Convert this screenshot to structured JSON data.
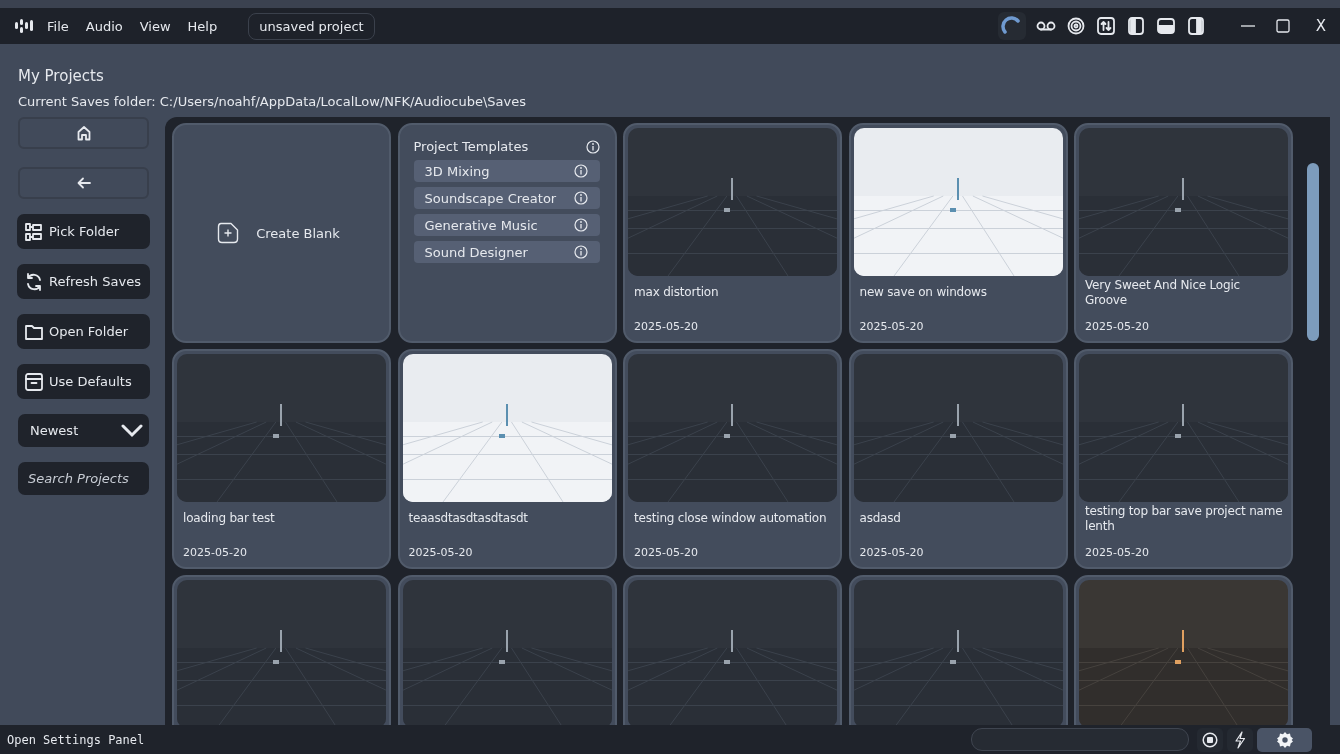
{
  "menu_bar": {
    "menus": [
      "File",
      "Audio",
      "View",
      "Help"
    ],
    "project_name": "unsaved project",
    "close_label": "X"
  },
  "header": {
    "title": "My Projects",
    "saves_folder": "Current Saves folder: C:/Users/noahf/AppData/LocalLow/NFK/Audiocube\\Saves"
  },
  "sidebar": {
    "actions": [
      {
        "kind": "pick",
        "label": "Pick Folder"
      },
      {
        "kind": "refresh",
        "label": "Refresh Saves"
      },
      {
        "kind": "open",
        "label": "Open Folder"
      },
      {
        "kind": "defaults",
        "label": "Use Defaults"
      }
    ],
    "sort": "Newest",
    "search": {
      "placeholder": "Search Projects"
    }
  },
  "create_blank": {
    "label": "Create Blank"
  },
  "templates": {
    "title": "Project Templates",
    "items": [
      "3D Mixing",
      "Soundscape Creator",
      "Generative Music",
      "Sound Designer"
    ]
  },
  "projects": [
    {
      "kind": "dark",
      "name": "max distortion",
      "date": "2025-05-20"
    },
    {
      "kind": "light",
      "name": "new save on windows",
      "date": "2025-05-20"
    },
    {
      "kind": "dark",
      "name": "Very Sweet And Nice Logic Groove",
      "date": "2025-05-20"
    },
    {
      "kind": "dark",
      "name": "loading bar test",
      "date": "2025-05-20"
    },
    {
      "kind": "light",
      "name": "teaasdtasdtasdtasdt",
      "date": "2025-05-20"
    },
    {
      "kind": "dark",
      "name": "testing close window automation",
      "date": "2025-05-20"
    },
    {
      "kind": "dark",
      "name": "asdasd",
      "date": "2025-05-20"
    },
    {
      "kind": "dark",
      "name": "testing top bar save project name lenth",
      "date": "2025-05-20"
    },
    {
      "kind": "dark"
    },
    {
      "kind": "dark"
    },
    {
      "kind": "dark"
    },
    {
      "kind": "dark"
    },
    {
      "kind": "warm"
    }
  ],
  "status_bar": {
    "hint": "Open Settings Panel"
  }
}
